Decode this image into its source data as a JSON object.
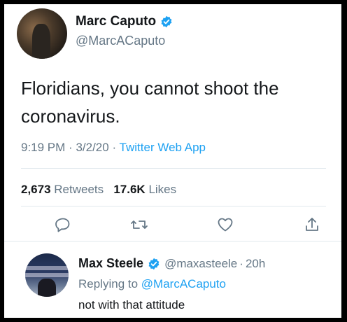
{
  "tweet": {
    "display_name": "Marc Caputo",
    "handle": "@MarcACaputo",
    "text": "Floridians, you cannot shoot the coronavirus.",
    "time": "9:19 PM",
    "date": "3/2/20",
    "source": "Twitter Web App",
    "retweets_count": "2,673",
    "retweets_label": "Retweets",
    "likes_count": "17.6K",
    "likes_label": "Likes",
    "separator": "·"
  },
  "reply": {
    "display_name": "Max Steele",
    "handle": "@maxasteele",
    "age": "20h",
    "replying_prefix": "Replying to",
    "replying_to": "@MarcACaputo",
    "text": "not with that attitude"
  },
  "icons": {
    "verified": "verified-badge-icon",
    "reply": "comment-bubble-icon",
    "retweet": "retweet-arrows-icon",
    "like": "heart-icon",
    "share": "share-upload-icon"
  },
  "colors": {
    "link": "#1da1f2",
    "secondary_text": "#657786",
    "primary_text": "#14171a",
    "divider": "#e1e8ed"
  }
}
